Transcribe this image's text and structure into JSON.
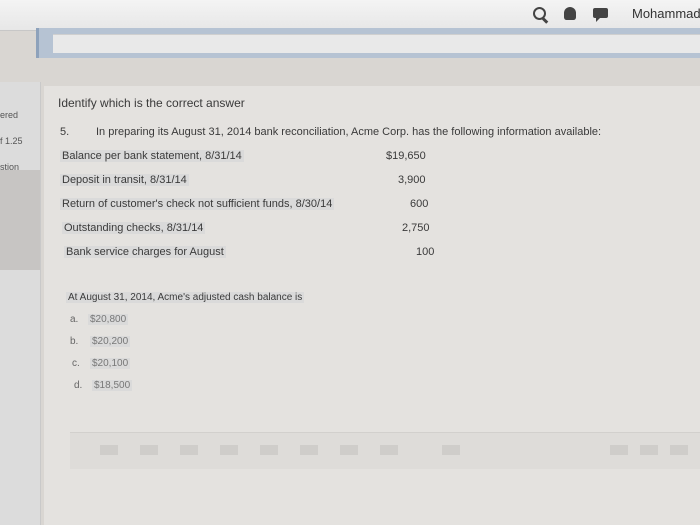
{
  "header": {
    "user_name": "Mohammad",
    "icons": [
      "search-icon",
      "bell-icon",
      "chat-icon"
    ]
  },
  "sidebar": {
    "labels": [
      "ered",
      "f 1.25",
      "stion"
    ]
  },
  "question": {
    "instruction": "Identify which is the correct answer",
    "number": "5.",
    "prompt": "In preparing its August 31, 2014 bank reconciliation, Acme Corp. has the following information available:",
    "items": [
      {
        "label": "Balance per bank statement, 8/31/14",
        "value": "$19,650"
      },
      {
        "label": "Deposit in transit, 8/31/14",
        "value": "3,900"
      },
      {
        "label": "Return of customer's check not sufficient funds, 8/30/14",
        "value": "600"
      },
      {
        "label": "Outstanding checks, 8/31/14",
        "value": "2,750"
      },
      {
        "label": "Bank service charges for August",
        "value": "100"
      }
    ],
    "ask": "At August 31, 2014, Acme's adjusted cash balance is",
    "options": [
      {
        "letter": "a.",
        "value": "$20,800"
      },
      {
        "letter": "b.",
        "value": "$20,200"
      },
      {
        "letter": "c.",
        "value": "$20,100"
      },
      {
        "letter": "d.",
        "value": "$18,500"
      }
    ]
  }
}
